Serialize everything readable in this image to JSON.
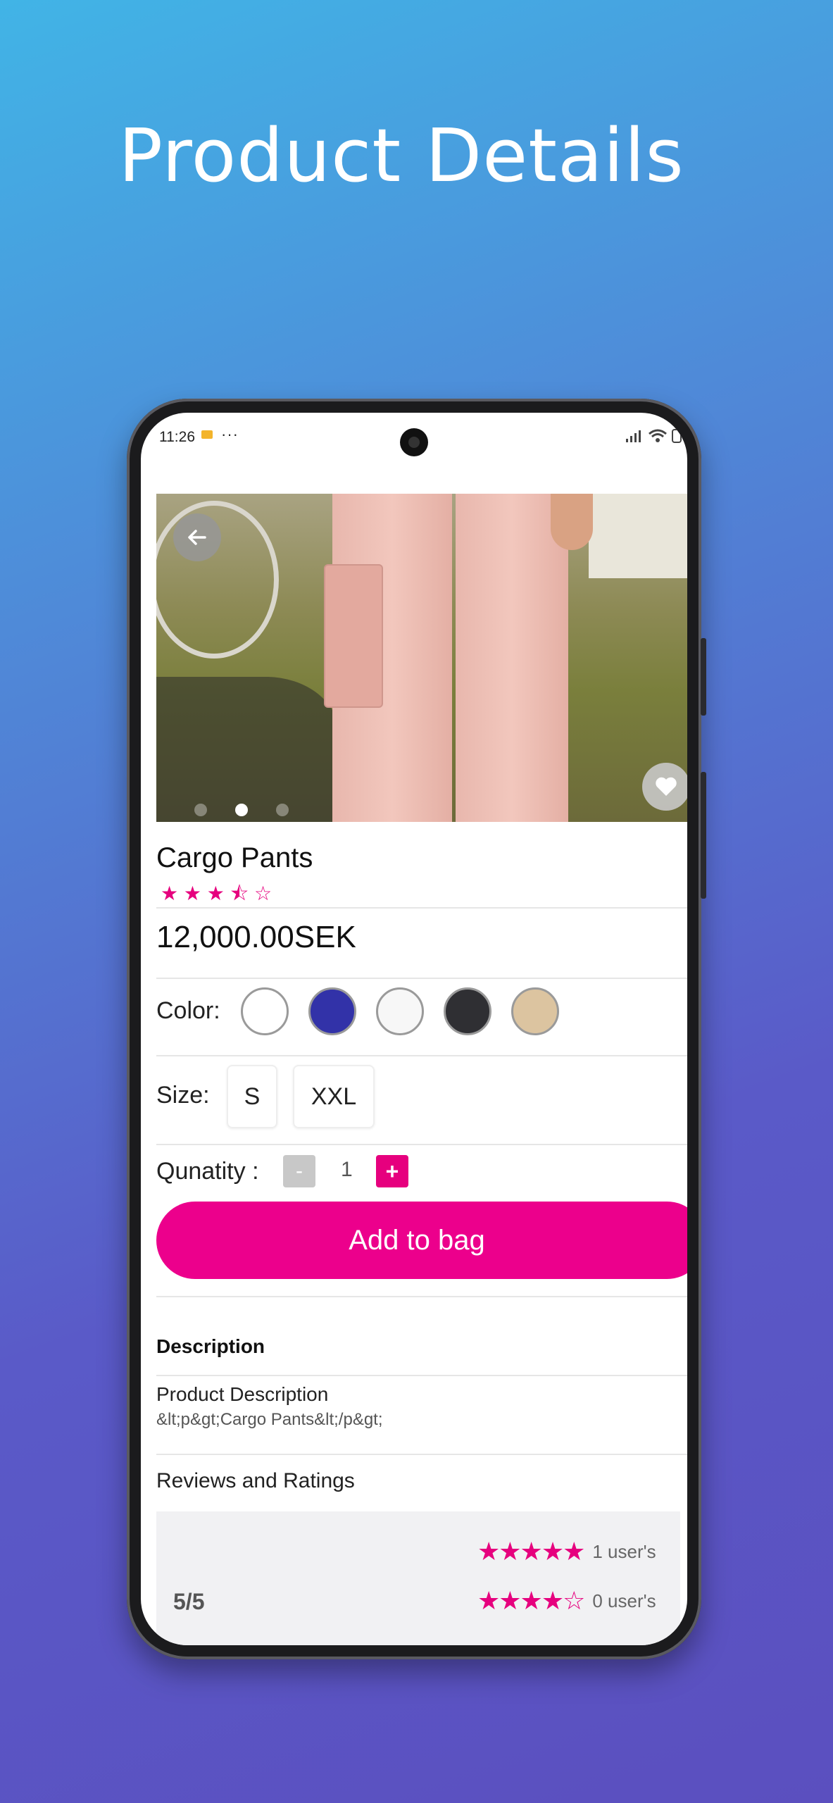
{
  "headline": "Product Details",
  "status_bar": {
    "time": "11:26",
    "extra": "···"
  },
  "product": {
    "name": "Cargo Pants",
    "rating_stars": "★ ★ ★ ⯪ ☆",
    "price": "12,000.00SEK"
  },
  "labels": {
    "color": "Color:",
    "size": "Size:",
    "quantity": "Qunatity :",
    "add_to_bag": "Add to bag",
    "description": "Description",
    "product_description": "Product Description",
    "reviews_and_ratings": "Reviews and Ratings"
  },
  "colors": [
    "#ffffff",
    "#3232a8",
    "#f7f7f7",
    "#2f2f33",
    "#dcc4a0"
  ],
  "sizes": [
    "S",
    "XXL"
  ],
  "quantity": {
    "minus": "-",
    "value": "1",
    "plus": "+"
  },
  "description_text": "&lt;p&gt;Cargo Pants&lt;/p&gt;",
  "reviews": {
    "score": "5/5",
    "rows": [
      {
        "stars": "★★★★★",
        "count": "1 user's"
      },
      {
        "stars": "★★★★☆",
        "count": "0 user's"
      }
    ]
  },
  "accent_color": "#e6007e",
  "image_carousel": {
    "pages": 3,
    "active_index": 1
  }
}
